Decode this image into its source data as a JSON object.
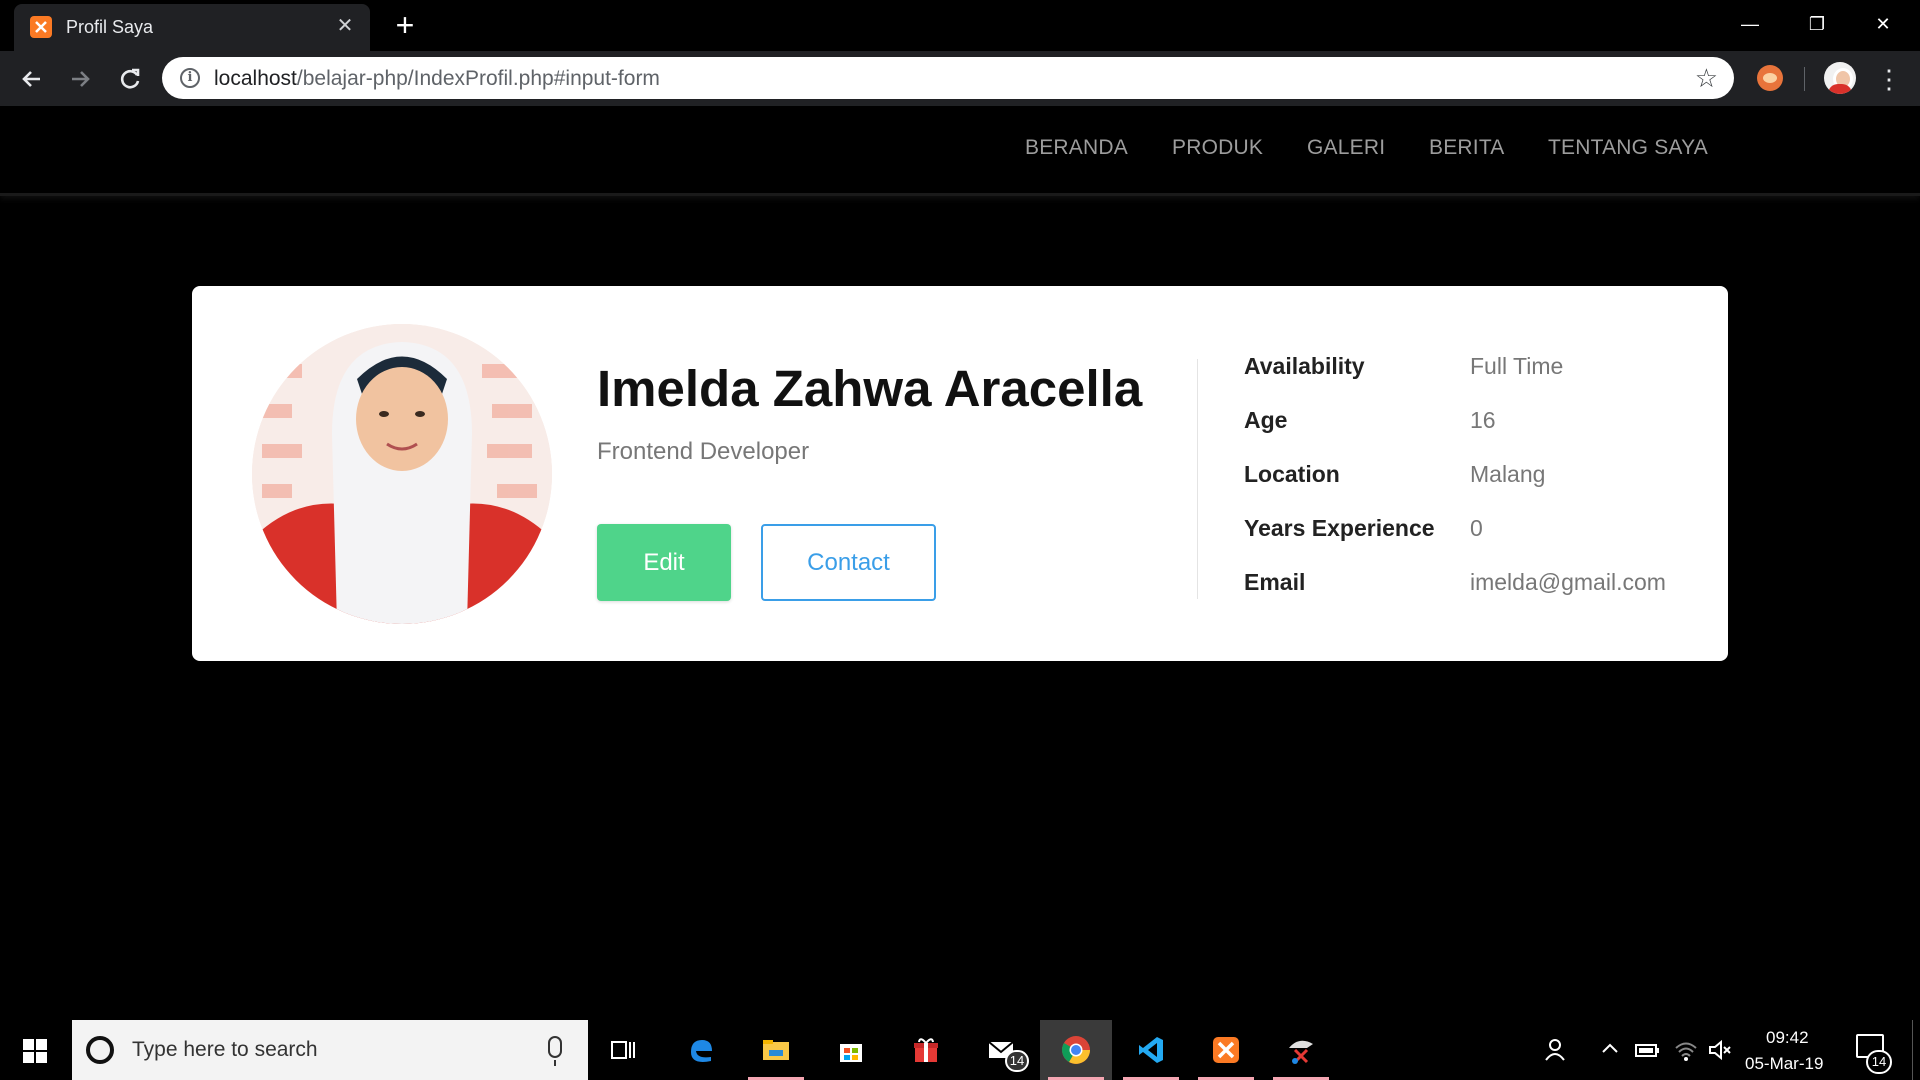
{
  "browser": {
    "tab_title": "Profil Saya",
    "tab_close": "✕",
    "new_tab": "+",
    "url_host": "localhost",
    "url_path": "/belajar-php/IndexProfil.php#input-form",
    "window_controls": {
      "minimize": "—",
      "maximize": "❐",
      "close": "✕"
    },
    "icons": [
      "back-icon",
      "forward-icon",
      "reload-icon",
      "info-icon",
      "star-icon",
      "extension-icon",
      "profile-avatar",
      "menu-icon"
    ]
  },
  "site_nav": {
    "items": [
      "BERANDA",
      "PRODUK",
      "GALERI",
      "BERITA",
      "TENTANG SAYA"
    ]
  },
  "profile": {
    "name": "Imelda Zahwa Aracella",
    "role": "Frontend Developer",
    "edit_label": "Edit",
    "contact_label": "Contact",
    "details": [
      {
        "label": "Availability",
        "value": "Full Time"
      },
      {
        "label": "Age",
        "value": "16"
      },
      {
        "label": "Location",
        "value": "Malang"
      },
      {
        "label": "Years Experience",
        "value": "0"
      },
      {
        "label": "Email",
        "value": "imelda@gmail.com"
      }
    ]
  },
  "colors": {
    "edit_button": "#4fd48a",
    "contact_button": "#3a9ee8",
    "nav_text": "#9d9d9d",
    "page_bg": "#000000"
  },
  "taskbar": {
    "search_placeholder": "Type here to search",
    "mail_badge": "14",
    "notification_badge": "14",
    "clock_time": "09:42",
    "clock_date": "05-Mar-19"
  }
}
